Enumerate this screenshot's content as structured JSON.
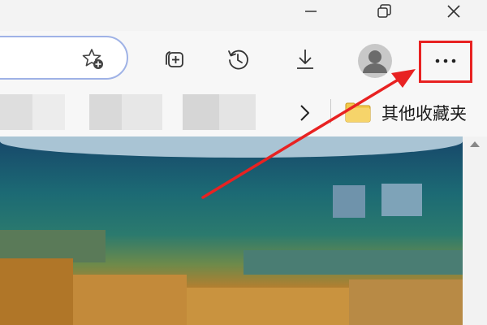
{
  "window_controls": {
    "minimize_icon": "minimize-icon",
    "restore_icon": "restore-icon",
    "close_icon": "close-icon"
  },
  "toolbar": {
    "favorite_icon": "add-favorite-icon",
    "collections_icon": "collections-icon",
    "history_icon": "history-icon",
    "downloads_icon": "download-icon",
    "profile_icon": "profile-avatar-icon",
    "more_icon": "more-options-icon"
  },
  "favorites_bar": {
    "overflow_icon": "chevron-right-icon",
    "folder_icon": "folder-icon",
    "folder_label": "其他收藏夹"
  },
  "annotation": {
    "highlight_color": "#e82222",
    "arrow_color": "#e82222"
  },
  "colors": {
    "address_border": "#9fb2e6",
    "folder_yellow": "#f2c94c"
  }
}
